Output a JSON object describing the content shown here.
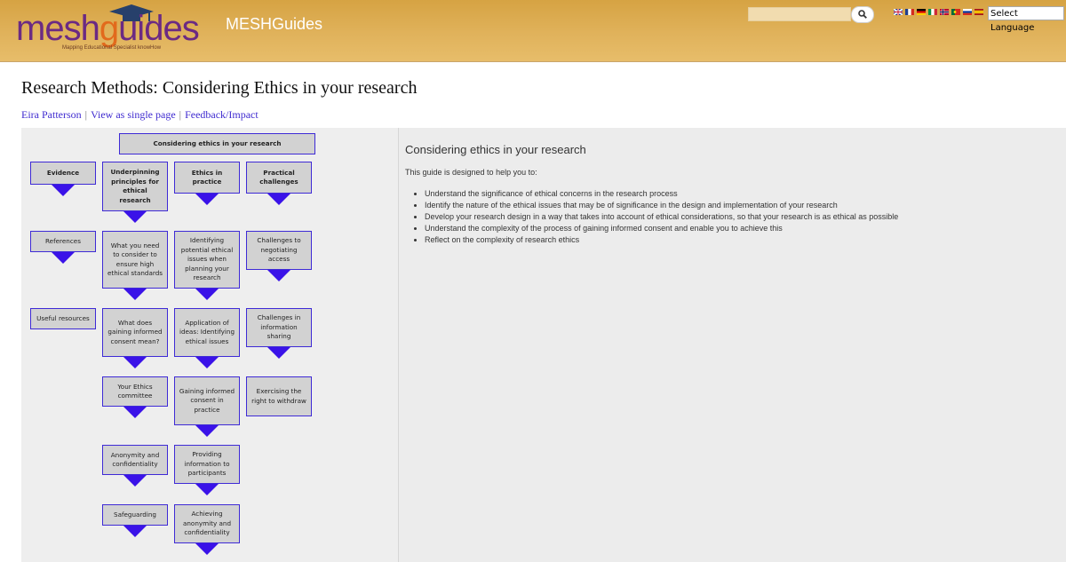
{
  "header": {
    "logo_text": "meshguides",
    "logo_tagline": "Mapping Educational Specialist knowHow",
    "site_title": "MESHGuides",
    "search": {
      "value": ""
    },
    "language_select": "Select Language",
    "flags": [
      "flag-uk",
      "flag-fr",
      "flag-de",
      "flag-it",
      "flag-no",
      "flag-pt",
      "flag-ru",
      "flag-es"
    ]
  },
  "page": {
    "title": "Research Methods: Considering Ethics in your research",
    "links": [
      "Eira Patterson",
      "View as single page",
      "Feedback/Impact"
    ]
  },
  "map": {
    "root": "Considering ethics in your research",
    "columns": [
      {
        "head": "Evidence",
        "items": [
          "References",
          "Useful resources"
        ]
      },
      {
        "head": "Underpinning principles for ethical research",
        "items": [
          "What you need to consider to ensure high ethical standards",
          "What does gaining informed consent mean?",
          "Your Ethics committee",
          "Anonymity and confidentiality",
          "Safeguarding"
        ]
      },
      {
        "head": "Ethics in practice",
        "items": [
          "Identifying potential ethical issues when planning your research",
          "Application of ideas: Identifying ethical issues",
          "Gaining informed consent in practice",
          "Providing information to participants",
          "Achieving anonymity and confidentiality"
        ]
      },
      {
        "head": "Practical challenges",
        "items": [
          "Challenges to negotiating access",
          "Challenges in information sharing",
          "Exercising the right to withdraw"
        ]
      }
    ]
  },
  "content": {
    "heading": "Considering ethics in your research",
    "intro": "This guide is designed to help you to:",
    "bullets": [
      "Understand the significance of ethical concerns in the research process",
      "Identify the nature of the ethical issues that may be of significance in the design and implementation of your research",
      "Develop your research design in a way that takes into account of ethical considerations, so that your research is as ethical as possible",
      "Understand the complexity of the process of gaining informed consent and enable you to achieve this",
      "Reflect on the complexity of research ethics"
    ]
  },
  "colors": {
    "header": "#dcaa4f",
    "node_border": "#3e2ad6",
    "arrow": "#3a12e8",
    "link": "#3f2bd0"
  }
}
